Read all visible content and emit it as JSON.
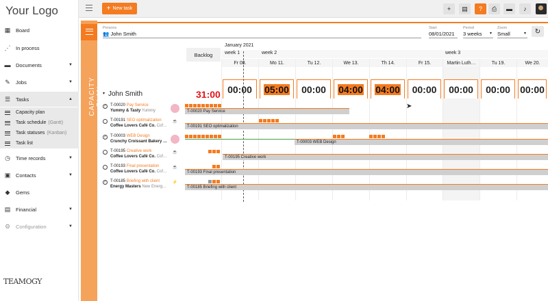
{
  "app": {
    "logo": "Your Logo",
    "brand": "TEAMOGY",
    "new_task": "New task"
  },
  "sidebar": {
    "items": [
      {
        "label": "Board",
        "icon": "grid-icon"
      },
      {
        "label": "In process",
        "icon": "flow-icon"
      },
      {
        "label": "Documents",
        "icon": "document-icon"
      },
      {
        "label": "Jobs",
        "icon": "wrench-icon"
      },
      {
        "label": "Tasks",
        "icon": "tasks-icon"
      },
      {
        "label": "Time records",
        "icon": "clock-icon"
      },
      {
        "label": "Contacts",
        "icon": "contacts-icon"
      },
      {
        "label": "Gems",
        "icon": "gem-icon"
      },
      {
        "label": "Financial",
        "icon": "money-icon"
      },
      {
        "label": "Configuration",
        "icon": "gear-icon"
      }
    ],
    "subitems": [
      {
        "label": "Capacity plan",
        "hint": ""
      },
      {
        "label": "Task schedule",
        "hint": "(Gantt)"
      },
      {
        "label": "Task statuses",
        "hint": "(Kanban)"
      },
      {
        "label": "Task list",
        "hint": ""
      }
    ]
  },
  "panel": {
    "side_title": "CAPACITY PLAN",
    "persons_label": "Persons",
    "person": "John Smith",
    "start_label": "Start",
    "start": "08/01/2021",
    "period_label": "Period",
    "period": "3 weeks",
    "zoom_label": "Zoom",
    "zoom": "Small"
  },
  "timeline": {
    "backlog": "Backlog",
    "month": "January 2021",
    "weeks": [
      "week 1",
      "week 2",
      "week 3"
    ],
    "days": [
      "Fr 08.",
      "Mo 11.",
      "Tu 12.",
      "We 13.",
      "Th 14.",
      "Fr 15.",
      "Martin Luth…",
      "Tu 19.",
      "We 20."
    ],
    "person_name": "John Smith",
    "total": "31:00",
    "capacity": [
      "00:00",
      "05:00",
      "00:00",
      "04:00",
      "04:00",
      "00:00",
      "00:00",
      "00:00",
      "00:00"
    ]
  },
  "tasks": [
    {
      "id": "T-00020",
      "name": "Pay Service",
      "customer": "Yummy & Tasty",
      "contact": "Yummy",
      "bar": "T-00020 Pay Service",
      "done": true
    },
    {
      "id": "T-00191",
      "name": "SEO optimalization",
      "customer": "Coffee Lovers Café Co.",
      "contact": "Cof…",
      "bar": "T-00191 SEO optimalization",
      "done": false
    },
    {
      "id": "T-00003",
      "name": "WEB Design",
      "customer": "Crunchy Croissant Bakery …",
      "contact": "",
      "bar": "T-00003 WEB Design",
      "done": true
    },
    {
      "id": "T-00195",
      "name": "Creative work",
      "customer": "Coffee Lovers Café Co.",
      "contact": "Cof…",
      "bar": "T-00195 Creative work",
      "done": false
    },
    {
      "id": "T-00193",
      "name": "Final presentation",
      "customer": "Coffee Lovers Café Co.",
      "contact": "Cof…",
      "bar": "T-00193 Final presentation",
      "done": false
    },
    {
      "id": "T-00185",
      "name": "Briefing with client",
      "customer": "Energy Masters",
      "contact": "New Energ…",
      "bar": "T-00185 Briefing with client",
      "done": true
    }
  ],
  "colors": {
    "accent": "#f47b20",
    "over": "#e0141a"
  }
}
